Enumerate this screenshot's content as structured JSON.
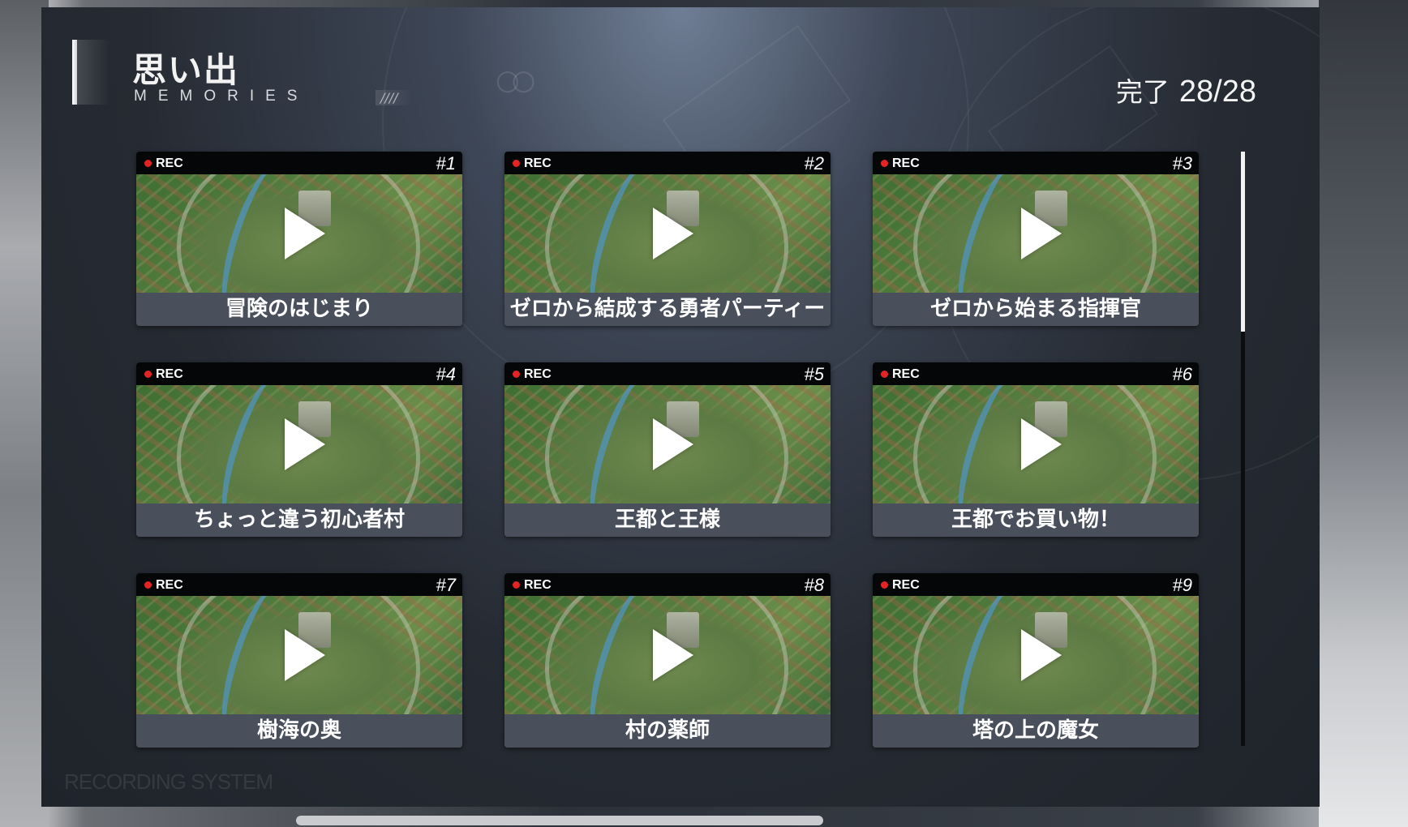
{
  "header": {
    "title_jp": "思い出",
    "title_en": "MEMORIES",
    "slashes": "////",
    "progress_label": "完了",
    "progress_value": "28/28"
  },
  "card_labels": {
    "rec": "REC"
  },
  "cards": [
    {
      "num": "#1",
      "title": "冒険のはじまり"
    },
    {
      "num": "#2",
      "title": "ゼロから結成する勇者パーティー"
    },
    {
      "num": "#3",
      "title": "ゼロから始まる指揮官"
    },
    {
      "num": "#4",
      "title": "ちょっと違う初心者村"
    },
    {
      "num": "#5",
      "title": "王都と王様"
    },
    {
      "num": "#6",
      "title": "王都でお買い物！"
    },
    {
      "num": "#7",
      "title": "樹海の奥"
    },
    {
      "num": "#8",
      "title": "村の薬師"
    },
    {
      "num": "#9",
      "title": "塔の上の魔女"
    }
  ],
  "footer": {
    "watermark": "RECORDING SYSTEM"
  },
  "colors": {
    "rec_dot": "#e32424",
    "card_title_bg": "#4a505b",
    "panel_bg": "#262b33"
  }
}
